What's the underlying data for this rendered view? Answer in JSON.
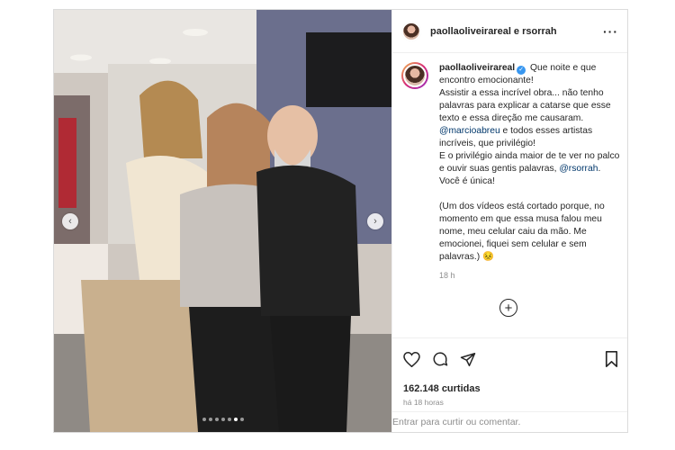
{
  "header": {
    "usernames": "paollaoliveirareal e rsorrah"
  },
  "caption": {
    "username": "paollaoliveirareal",
    "verified_mark": "✓",
    "line_1": "Que noite e que encontro emocionante!",
    "line_2a": "Assistir a essa incrível obra... não tenho palavras para explicar a catarse que esse texto e essa direção me causaram. ",
    "mention_1": "@marcioabreu",
    "line_2b": " e todos esses artistas incríveis, que privilégio!",
    "line_3a": "E o privilégio ainda maior de te ver no palco e ouvir suas gentis palavras, ",
    "mention_2": "@rsorrah",
    "line_3b": ". Você é única!",
    "para_2": "(Um dos vídeos está cortado porque, no momento em que essa musa falou meu nome, meu celular caiu da mão. Me emocionei, fiquei sem celular e sem palavras.) 😣",
    "time": "18 h"
  },
  "more_comments_icon": "plus-circle-icon",
  "actions": {
    "icons": [
      "heart-icon",
      "comment-icon",
      "share-icon",
      "bookmark-icon"
    ],
    "likes": "162.148 curtidas",
    "ago": "há 18 horas"
  },
  "login": {
    "link": "Entrar",
    "text": " para curtir ou comentar."
  },
  "carousel": {
    "prev_icon": "‹",
    "next_icon": "›",
    "slide_count": 7,
    "active_index": 5
  }
}
